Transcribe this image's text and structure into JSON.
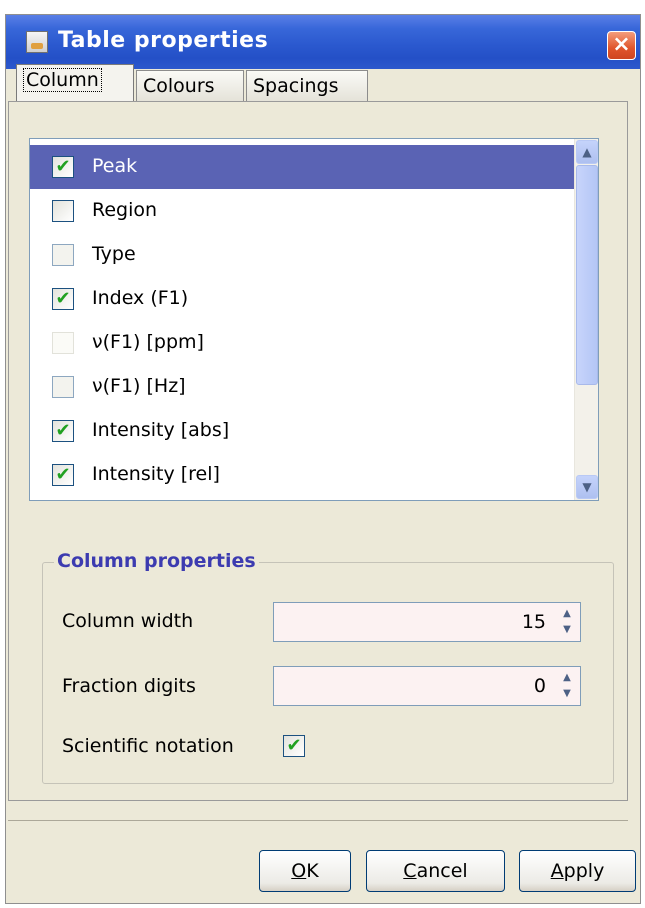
{
  "window": {
    "title": "Table properties",
    "close_glyph": "×"
  },
  "tabs": [
    {
      "label": "Column",
      "active": true
    },
    {
      "label": "Colours",
      "active": false
    },
    {
      "label": "Spacings",
      "active": false
    }
  ],
  "columns_list": {
    "items": [
      {
        "label": "Peak",
        "checked": true,
        "selected": true
      },
      {
        "label": "Region",
        "checked": false
      },
      {
        "label": "Type",
        "checked": false
      },
      {
        "label": "Index (F1)",
        "checked": true
      },
      {
        "label": "ν(F1) [ppm]",
        "checked": false
      },
      {
        "label": "ν(F1) [Hz]",
        "checked": false
      },
      {
        "label": "Intensity [abs]",
        "checked": true
      },
      {
        "label": "Intensity [rel]",
        "checked": true
      }
    ]
  },
  "column_properties": {
    "title": "Column properties",
    "column_width_label": "Column width",
    "column_width_value": "15",
    "fraction_digits_label": "Fraction digits",
    "fraction_digits_value": "0",
    "scientific_notation_label": "Scientific notation",
    "scientific_notation_checked": true
  },
  "buttons": {
    "ok_mnemonic": "O",
    "ok_rest": "K",
    "cancel_mnemonic": "C",
    "cancel_rest": "ancel",
    "apply_mnemonic": "A",
    "apply_rest": "pply"
  },
  "icons": {
    "check": "✔",
    "up": "▲",
    "down": "▼"
  },
  "colors": {
    "titlebar": "#2b59cf",
    "selection": "#5a63b4",
    "group_title": "#3c3bb0"
  }
}
